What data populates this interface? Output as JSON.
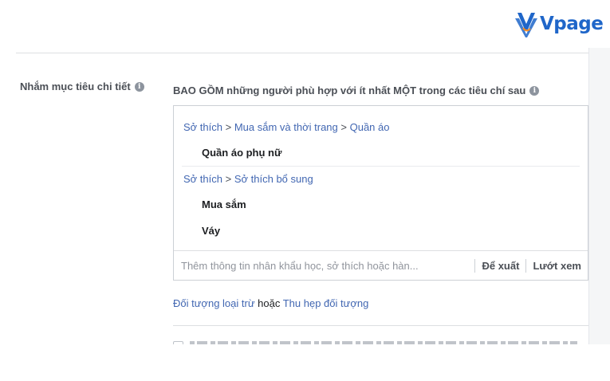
{
  "brand": {
    "name": "Vpage",
    "color": "#1f66c9",
    "icon": "vpage-logo-icon"
  },
  "targeting": {
    "label": "Nhắm mục tiêu chi tiết",
    "label_icon": "info-icon",
    "include_label": "BAO GỒM những người phù hợp với ít nhất MỘT trong các tiêu chí sau",
    "include_icon": "info-icon",
    "groups": [
      {
        "path": [
          "Sở thích",
          "Mua sắm và thời trang",
          "Quần áo"
        ],
        "separator": ">",
        "items": [
          "Quần áo phụ nữ"
        ]
      },
      {
        "path": [
          "Sở thích",
          "Sở thích bổ sung"
        ],
        "separator": ">",
        "items": [
          "Mua sắm",
          "Váy"
        ]
      }
    ],
    "search": {
      "placeholder": "Thêm thông tin nhân khẩu học, sở thích hoặc hàn...",
      "suggest_label": "Để xuất",
      "browse_label": "Lướt xem"
    },
    "exclude_link": "Đối tượng loại trừ",
    "or_text": "hoặc",
    "narrow_link": "Thu hẹp đối tượng"
  },
  "colors": {
    "link": "#4267b2",
    "label": "#4b4f56",
    "border": "#ccd0d5"
  }
}
